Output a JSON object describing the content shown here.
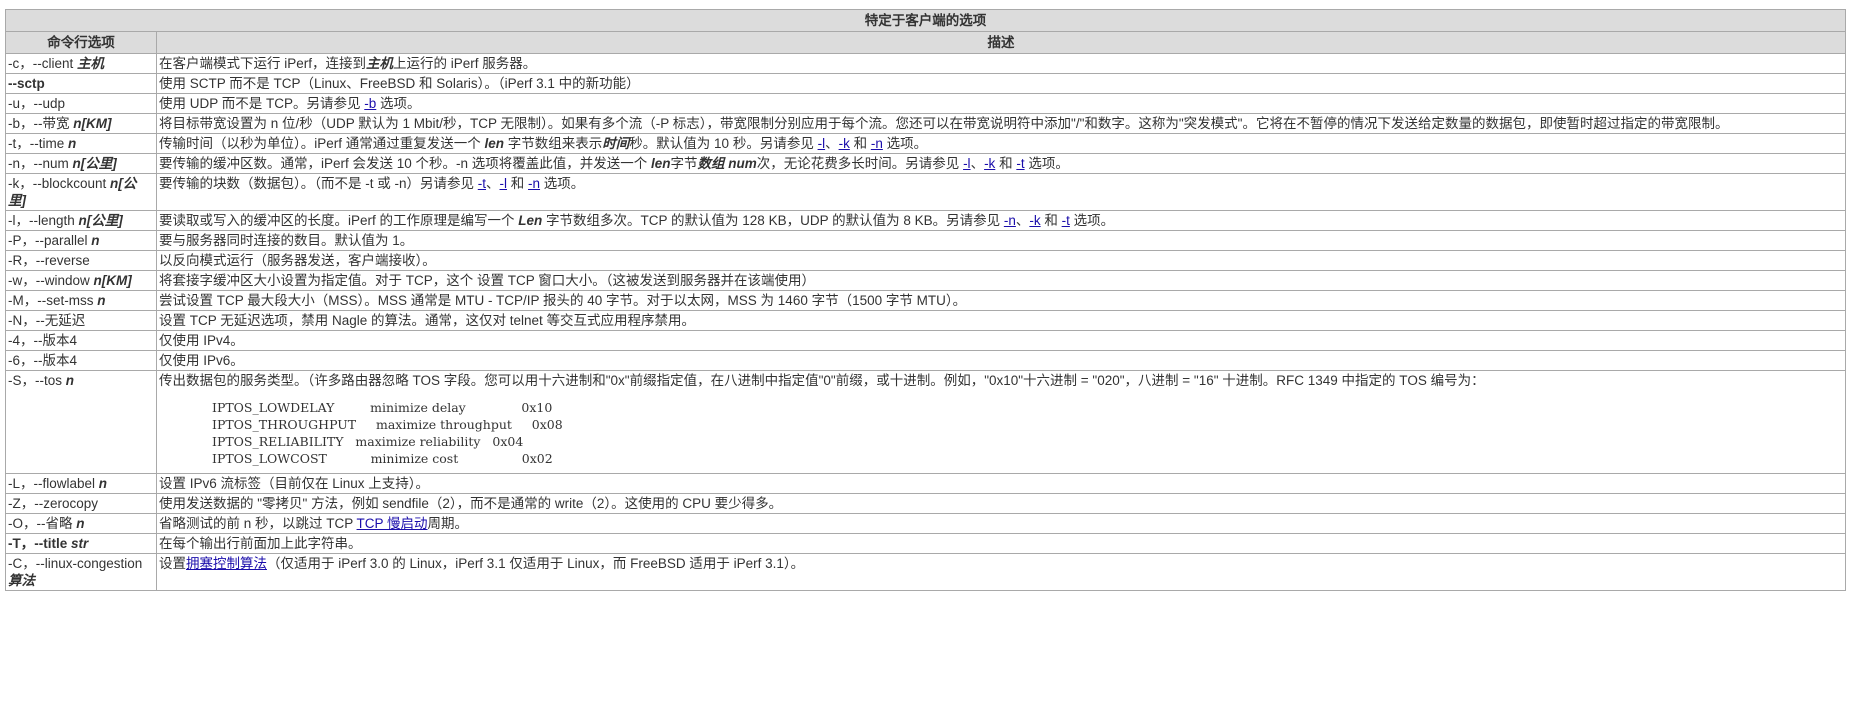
{
  "table": {
    "title": "特定于客户端的选项",
    "col_option": "命令行选项",
    "col_desc": "描述"
  },
  "rows": {
    "c": {
      "flag": "-c，--client ",
      "arg": "主机",
      "d1": "在客户端模式下运行 iPerf，连接到",
      "d2": "主机",
      "d3": "上运行的 iPerf 服务器。"
    },
    "sctp": {
      "flag": "--sctp",
      "desc": "使用 SCTP 而不是 TCP（Linux、FreeBSD 和 Solaris）。（iPerf 3.1 中的新功能）"
    },
    "u": {
      "flag": "-u，--udp",
      "d1": "使用 UDP 而不是 TCP。另请参见 ",
      "link": "-b",
      "d2": " 选项。"
    },
    "b": {
      "flag": "-b，--带宽 ",
      "arg": "n[KM]",
      "desc": "将目标带宽设置为 n 位/秒（UDP 默认为 1 Mbit/秒，TCP 无限制）。如果有多个流（-P 标志），带宽限制分别应用于每个流。您还可以在带宽说明符中添加\"/\"和数字。这称为\"突发模式\"。它将在不暂停的情况下发送给定数量的数据包，即使暂时超过指定的带宽限制。"
    },
    "t": {
      "flag": "-t，--time ",
      "arg": "n",
      "d1": "传输时间（以秒为单位）。iPerf 通常通过重复发送一个 ",
      "d2": "len",
      "d3": " 字节数组来表示",
      "d4": "时间",
      "d5": "秒。默认值为 10 秒。另请参见 ",
      "l1": "-l",
      "s1": "、",
      "l2": "-k",
      "s2": " 和 ",
      "l3": "-n",
      "d6": " 选项。"
    },
    "n": {
      "flag": "-n，--num ",
      "arg": "n[公里]",
      "d1": "要传输的缓冲区数。通常，iPerf 会发送 10 个秒。-n 选项将覆盖此值，并发送一个 ",
      "d2": "len",
      "d3": "字节",
      "d4": "数组 num",
      "d5": "次，无论花费多长时间。另请参见 ",
      "l1": "-l",
      "s1": "、",
      "l2": "-k",
      "s2": " 和 ",
      "l3": "-t",
      "d6": " 选项。"
    },
    "k": {
      "flag": "-k，--blockcount ",
      "arg": "n[公里]",
      "d1": "要传输的块数（数据包）。（而不是 -t 或 -n）另请参见 ",
      "l1": "-t",
      "s1": "、",
      "l2": "-l",
      "s2": " 和 ",
      "l3": "-n",
      "d2": " 选项。"
    },
    "l": {
      "flag": "-l，--length ",
      "arg": "n[公里]",
      "d1": "要读取或写入的缓冲区的长度。iPerf 的工作原理是编写一个 ",
      "d2": "Len",
      "d3": " 字节数组多次。TCP 的默认值为 128 KB，UDP 的默认值为 8 KB。另请参见 ",
      "l1": "-n",
      "s1": "、",
      "l2": "-k",
      "s2": " 和 ",
      "l3": "-t",
      "d4": " 选项。"
    },
    "P": {
      "flag": "-P，--parallel ",
      "arg": "n",
      "desc": "要与服务器同时连接的数目。默认值为 1。"
    },
    "R": {
      "flag": "-R，--reverse",
      "desc": "以反向模式运行（服务器发送，客户端接收）。"
    },
    "w": {
      "flag": "-w，--window ",
      "arg": "n[KM]",
      "desc": "将套接字缓冲区大小设置为指定值。对于 TCP，这个 设置 TCP 窗口大小。（这被发送到服务器并在该端使用）"
    },
    "M": {
      "flag": "-M，--set-mss ",
      "arg": "n",
      "desc": "尝试设置 TCP 最大段大小（MSS）。MSS 通常是 MTU - TCP/IP 报头的 40 字节。对于以太网，MSS 为 1460 字节（1500 字节 MTU）。"
    },
    "N": {
      "flag": "-N，--无延迟",
      "desc": "设置 TCP 无延迟选项，禁用 Nagle 的算法。通常，这仅对 telnet 等交互式应用程序禁用。"
    },
    "v4": {
      "flag": "-4，--版本4",
      "desc": "仅使用 IPv4。"
    },
    "v6": {
      "flag": "-6，--版本4",
      "desc": "仅使用 IPv6。"
    },
    "S": {
      "flag": "-S，--tos ",
      "arg": "n",
      "desc": "传出数据包的服务类型。（许多路由器忽略 TOS 字段。您可以用十六进制和\"0x\"前缀指定值，在八进制中指定值\"0\"前缀，或十进制。例如，\"0x10\"十六进制 = \"020\"，八进制 = \"16\" 十进制。RFC 1349 中指定的 TOS 编号为：",
      "pre": "IPTOS_LOWDELAY         minimize delay              0x10\nIPTOS_THROUGHPUT     maximize throughput     0x08\nIPTOS_RELIABILITY   maximize reliability   0x04\nIPTOS_LOWCOST           minimize cost                0x02"
    },
    "L": {
      "flag": "-L，--flowlabel ",
      "arg": "n",
      "desc": "设置 IPv6 流标签（目前仅在 Linux 上支持）。"
    },
    "Z": {
      "flag": "-Z，--zerocopy",
      "desc": "使用发送数据的 \"零拷贝\" 方法，例如 sendfile（2），而不是通常的 write（2）。这使用的 CPU 要少得多。"
    },
    "O": {
      "flag": "-O，--省略 ",
      "arg": "n",
      "d1": "省略测试的前 n 秒，以跳过 TCP ",
      "link": "TCP 慢启动",
      "d2": "周期。"
    },
    "T": {
      "flag": "-T，--title ",
      "arg": "str",
      "desc": "在每个输出行前面加上此字符串。"
    },
    "C": {
      "flag": "-C，--linux-congestion ",
      "arg": "算法",
      "d1": "设置",
      "link": "拥塞控制算法",
      "d2": "（仅适用于 iPerf 3.0 的 Linux，iPerf 3.1 仅适用于 Linux，而 FreeBSD 适用于 iPerf 3.1）。"
    }
  }
}
